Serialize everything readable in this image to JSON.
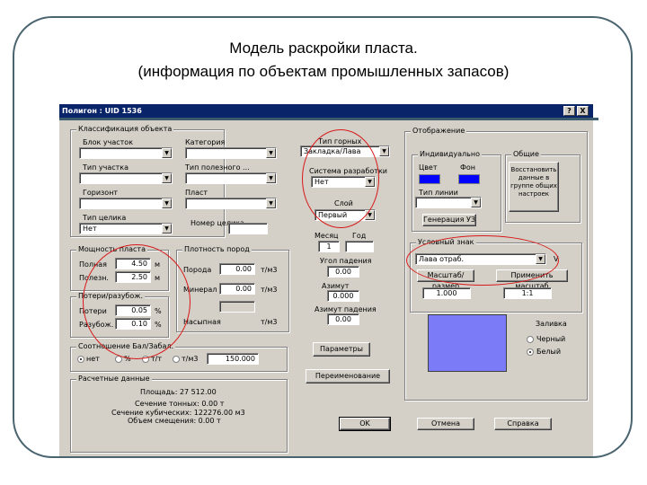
{
  "slide": {
    "title_line1": "Модель раскройки пласта.",
    "title_line2": "(информация по объектам промышленных запасов)"
  },
  "dialog": {
    "title": "Полигон : UID      1536",
    "help_label": "?",
    "close_label": "X",
    "classification": {
      "group_label": "Классификация объекта",
      "site_label": "Блок участок",
      "category_label": "Категория",
      "hoard_type_label": "Тип участка",
      "deposit_type_label": "Тип полезного ...",
      "horizon_label": "Горизонт",
      "seam_label": "Пласт",
      "pillar_type_label": "Тип целика",
      "pillar_type_value": "Нет",
      "pillar_no_label": "Номер целика"
    },
    "thickness": {
      "group_label": "Мощность пласта",
      "full_label": "Полная",
      "full_value": "4.50",
      "full_unit": "м",
      "useful_label": "Полезн.",
      "useful_value": "2.50",
      "useful_unit": "м"
    },
    "losses": {
      "group_label": "Потери/разубож.",
      "losses_label": "Потери",
      "losses_value": "0.05",
      "losses_unit": "%",
      "dilution_label": "Разубож.",
      "dilution_value": "0.10",
      "dilution_unit": "%"
    },
    "density": {
      "group_label": "Плотность пород",
      "rock_label": "Порода",
      "rock_value": "0.00",
      "rock_unit": "т/м3",
      "mineral_label": "Минерал",
      "mineral_value": "0.00",
      "mineral_unit": "т/м3",
      "bulk_label": "Насыпная",
      "bulk_value": "",
      "bulk_unit": "т/м3"
    },
    "ratio": {
      "group_label": "Соотношение Бал/Забал.",
      "options": [
        "нет",
        "%",
        "т/т",
        "т/м3"
      ],
      "value": "150.000"
    },
    "calc": {
      "group_label": "Расчетные данные",
      "line1": "Площадь: 27 512.00",
      "line2": "Сечение тонных: 0.00 т",
      "line3": "Сечение кубических: 122276.00 м3",
      "line4": "Объем смещения: 0.00 т"
    },
    "mid": {
      "mining_type_label": "Тип горных",
      "mining_type_value": "Закладка/Лава",
      "system_label": "Система разработки",
      "system_value": "Нет",
      "layer_label": "Слой",
      "layer_value": "Первый",
      "month_label": "Месяц",
      "month_value": "1",
      "year_label": "Год",
      "year_value": "",
      "dip_label": "Угол падения",
      "dip_value": "0.00",
      "azimuth_label": "Азимут",
      "azimuth_value": "0.000",
      "strike_label": "Азимут падения",
      "strike_value": "0.00",
      "params_btn": "Параметры",
      "rename_btn": "Переименование"
    },
    "display": {
      "group_label": "Отображение",
      "individual_label": "Индивидуально",
      "line_label": "Цвет",
      "fill_label": "Фон",
      "line_type_label": "Тип линии",
      "common_label": "Общие",
      "restore_btn": "Восстановить данные в группе общих настроек",
      "generate_btn": "Генерация УЗ",
      "sign_label": "Условный знак",
      "sign_value": "Лава отраб.",
      "sign_value_suffix": "V",
      "scale_btn": "Масштаб/размер",
      "apply_btn": "Применить масштаб",
      "scale_value": "1.000",
      "ratio_value": "1:1",
      "fill_label2": "Заливка",
      "black_label": "Черный",
      "white_label": "Белый"
    },
    "buttons": {
      "ok": "OK",
      "cancel": "Отмена",
      "help": "Справка"
    }
  },
  "colors": {
    "titlebar": "#0a246a",
    "dialog_bg": "#d4d0c8",
    "swatch_line": "#0000ff",
    "swatch_fill": "#0000ff",
    "preview_fill": "#7b7bf7",
    "annotation_red": "#d81818",
    "frame": "#4a6470"
  }
}
